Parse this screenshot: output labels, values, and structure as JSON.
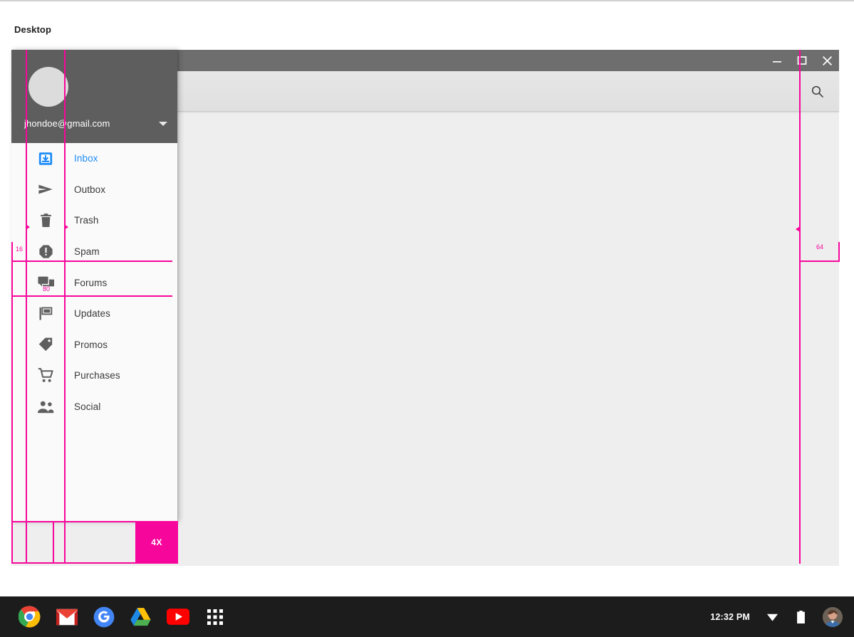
{
  "desktop": {
    "label": "Desktop"
  },
  "window": {
    "controls": {
      "minimize": "minimize-button",
      "maximize": "maximize-button",
      "close": "close-button"
    },
    "toolbar": {
      "search_icon": "search-icon"
    }
  },
  "drawer": {
    "account_email": "jhondoe@gmail.com",
    "caret_icon": "chevron-down-icon",
    "avatar_icon": "avatar",
    "items": [
      {
        "label": "Inbox",
        "icon": "inbox-icon",
        "active": true
      },
      {
        "label": "Outbox",
        "icon": "send-icon",
        "active": false
      },
      {
        "label": "Trash",
        "icon": "trash-icon",
        "active": false
      },
      {
        "label": "Spam",
        "icon": "report-icon",
        "active": false
      },
      {
        "label": "Forums",
        "icon": "forum-icon",
        "active": false
      },
      {
        "label": "Updates",
        "icon": "flag-icon",
        "active": false
      },
      {
        "label": "Promos",
        "icon": "tag-icon",
        "active": false
      },
      {
        "label": "Purchases",
        "icon": "cart-icon",
        "active": false
      },
      {
        "label": "Social",
        "icon": "people-icon",
        "active": false
      }
    ]
  },
  "redlines": {
    "accent_color": "#f7069c",
    "measure_left": "16",
    "measure_icon_gap": "80",
    "measure_right": "64",
    "scale_label": "4X"
  },
  "shelf": {
    "apps": [
      {
        "name": "chrome-icon"
      },
      {
        "name": "gmail-icon"
      },
      {
        "name": "google-icon"
      },
      {
        "name": "drive-icon"
      },
      {
        "name": "youtube-icon"
      },
      {
        "name": "app-launcher-icon"
      }
    ],
    "time": "12:32 PM",
    "wifi_icon": "wifi-icon",
    "battery_icon": "battery-icon",
    "avatar_icon": "user-avatar"
  }
}
